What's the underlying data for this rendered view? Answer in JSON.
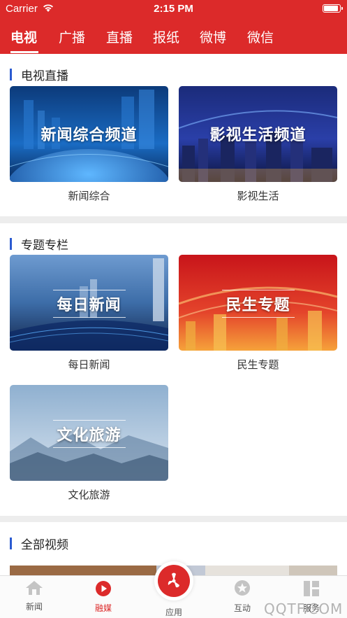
{
  "status_bar": {
    "carrier": "Carrier",
    "time": "2:15 PM",
    "battery_level": 0.95
  },
  "top_nav": {
    "tabs": [
      {
        "label": "电视",
        "active": true
      },
      {
        "label": "广播",
        "active": false
      },
      {
        "label": "直播",
        "active": false
      },
      {
        "label": "报纸",
        "active": false
      },
      {
        "label": "微博",
        "active": false
      },
      {
        "label": "微信",
        "active": false
      }
    ]
  },
  "sections": {
    "live": {
      "title": "电视直播",
      "cards": [
        {
          "image_text": "新闻综合频道",
          "caption": "新闻综合"
        },
        {
          "image_text": "影视生活频道",
          "caption": "影视生活"
        }
      ]
    },
    "topics": {
      "title": "专题专栏",
      "cards": [
        {
          "image_text": "每日新闻",
          "caption": "每日新闻"
        },
        {
          "image_text": "民生专题",
          "caption": "民生专题"
        },
        {
          "image_text": "文化旅游",
          "caption": "文化旅游"
        }
      ]
    },
    "all_videos": {
      "title": "全部视频"
    }
  },
  "tab_bar": {
    "items": [
      {
        "label": "新闻",
        "icon": "home-icon",
        "active": false
      },
      {
        "label": "融媒",
        "icon": "play-circle-icon",
        "active": true
      },
      {
        "label": "应用",
        "icon": "fan-icon",
        "active": false
      },
      {
        "label": "互动",
        "icon": "star-bubble-icon",
        "active": false
      },
      {
        "label": "服务",
        "icon": "grid-icon",
        "active": false
      }
    ]
  },
  "watermark": "QQTF.COM",
  "colors": {
    "brand_red": "#dc2a2a",
    "accent_blue": "#2b5bd1"
  }
}
